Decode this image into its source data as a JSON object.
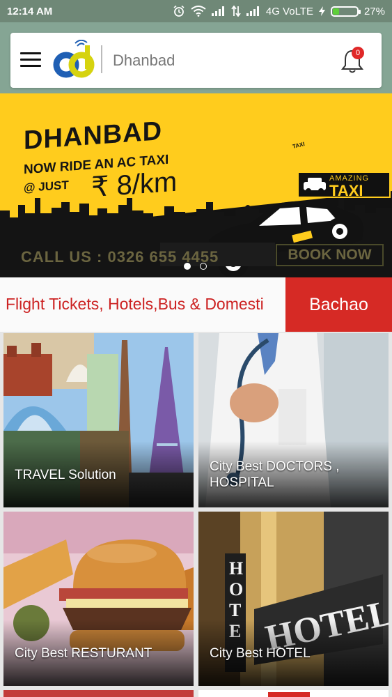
{
  "status_bar": {
    "time": "12:14 AM",
    "network": "4G VoLTE",
    "battery": "27%",
    "battery_level": 0.27,
    "icons": [
      "alarm-icon",
      "wifi-icon",
      "signal-icon",
      "data-arrows-icon",
      "signal-icon",
      "charging-icon"
    ]
  },
  "header": {
    "city": "Dhanbad",
    "notification_count": "0",
    "icons": [
      "menu-icon",
      "app-logo",
      "bell-icon"
    ]
  },
  "banner": {
    "title": "DHANBAD",
    "line2": "NOW RIDE AN AC TAXI",
    "just": "@ JUST",
    "price": "₹ 8/km",
    "brand_top": "AMAZING",
    "brand_bottom": "TAXI",
    "taxi_tag": "TAXI",
    "call": "CALL US : 0326 655 4455",
    "book": "BOOK NOW",
    "slide_count": 2,
    "active_slide": 1
  },
  "marquee": {
    "text": "Flight Tickets, Hotels,Bus & Domesti"
  },
  "bachao_button": "Bachao",
  "tiles": [
    {
      "label": "TRAVEL Solution"
    },
    {
      "label": "City Best DOCTORS , HOSPITAL"
    },
    {
      "label": "City Best  RESTURANT"
    },
    {
      "label": "City Best  HOTEL"
    }
  ],
  "colors": {
    "status_bar": "#6f8877",
    "header_bg": "#85a594",
    "banner_yellow": "#ffcc1d",
    "accent_red": "#d62a25",
    "marquee_text": "#cc2222",
    "badge_red": "#e02828"
  }
}
